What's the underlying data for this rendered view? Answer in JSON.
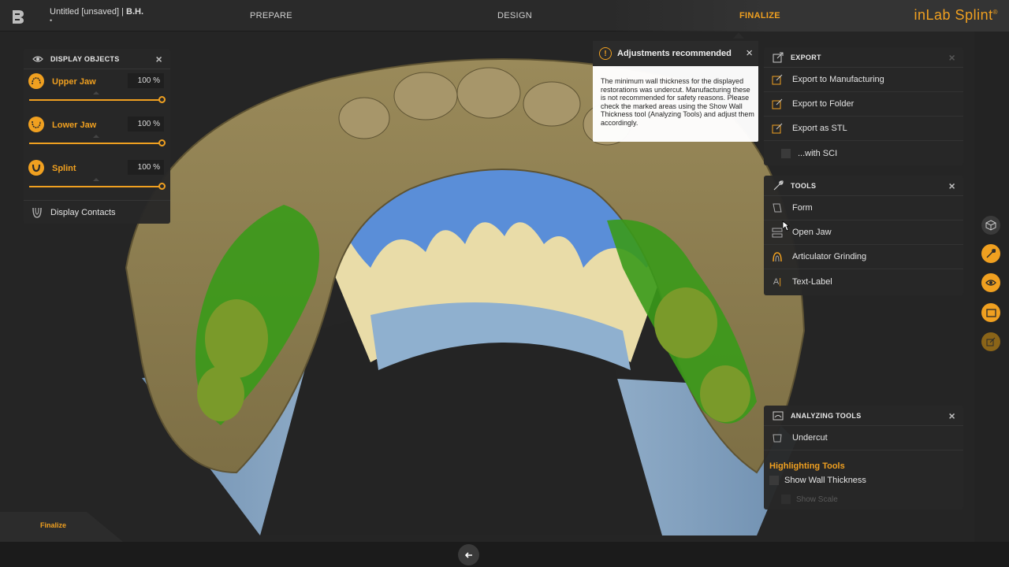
{
  "topbar": {
    "doc_title": "Untitled [unsaved] |",
    "patient": "B.H.",
    "dirty_marker": "•",
    "steps": [
      "PREPARE",
      "DESIGN",
      "FINALIZE"
    ],
    "active_step": "FINALIZE",
    "brand": "inLab Splint",
    "brand_mark": "®",
    "accent_color": "#f0a020"
  },
  "display_objects": {
    "title": "DISPLAY OBJECTS",
    "items": [
      {
        "label": "Upper Jaw",
        "value": "100 %",
        "level": 1.0,
        "icon": "upper-jaw-icon"
      },
      {
        "label": "Lower Jaw",
        "value": "100 %",
        "level": 1.0,
        "icon": "lower-jaw-icon"
      },
      {
        "label": "Splint",
        "value": "100 %",
        "level": 1.0,
        "icon": "splint-icon"
      }
    ],
    "contacts_label": "Display Contacts"
  },
  "warning": {
    "title": "Adjustments recommended",
    "body": "The minimum wall thickness for the displayed restorations was undercut. Manufacturing these is not recommended for safety reasons. Please check the marked areas using the Show Wall Thickness tool (Analyzing Tools) and adjust them accordingly."
  },
  "export": {
    "title": "EXPORT",
    "items": [
      "Export to Manufacturing",
      "Export to Folder",
      "Export as STL"
    ],
    "sci_label": "...with SCI"
  },
  "tools": {
    "title": "TOOLS",
    "items": [
      "Form",
      "Open Jaw",
      "Articulator Grinding",
      "Text-Label"
    ]
  },
  "analyzing": {
    "title": "ANALYZING TOOLS",
    "undercut": "Undercut",
    "highlight_title": "Highlighting Tools",
    "wall_thickness": "Show Wall Thickness",
    "show_scale": "Show Scale"
  },
  "bottom": {
    "phase_label": "Finalize"
  }
}
